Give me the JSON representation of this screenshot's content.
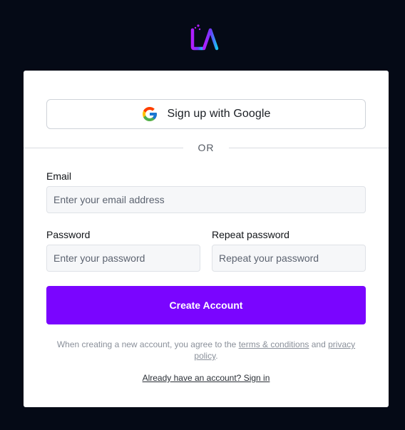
{
  "brand": {
    "logo_icon": "la-logo-icon"
  },
  "google": {
    "label": "Sign up with Google",
    "icon": "google-g-icon"
  },
  "divider": {
    "text": "OR"
  },
  "email": {
    "label": "Email",
    "placeholder": "Enter your email address",
    "value": ""
  },
  "password": {
    "label": "Password",
    "placeholder": "Enter your password",
    "value": ""
  },
  "repeat_password": {
    "label": "Repeat password",
    "placeholder": "Repeat your password",
    "value": ""
  },
  "submit": {
    "label": "Create Account"
  },
  "terms": {
    "prefix": "When creating a new account, you agree to the ",
    "terms_link": "terms & conditions",
    "middle": " and ",
    "privacy_link": "privacy policy",
    "suffix": "."
  },
  "signin": {
    "label": "Already have an account? Sign in"
  },
  "colors": {
    "page_background": "#050a16",
    "card_background": "#ffffff",
    "accent": "#7a05ff",
    "logo_gradient_start": "#b31dff",
    "logo_gradient_end": "#17c4f0"
  }
}
